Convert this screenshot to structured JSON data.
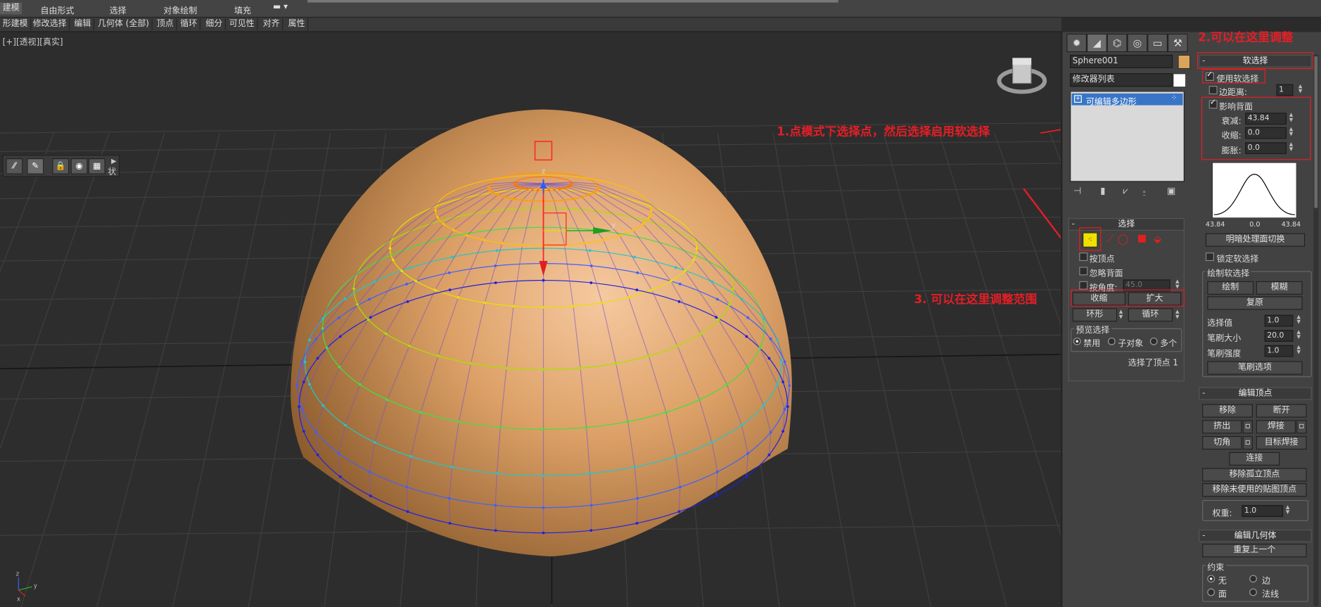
{
  "ribbon": {
    "tabs": [
      "建模",
      "自由形式",
      "选择",
      "对象绘制",
      "填充"
    ],
    "commands": [
      "形建模",
      "修改选择",
      "编辑",
      "几何体 (全部)",
      "顶点",
      "循环",
      "细分",
      "可见性",
      "对齐",
      "属性"
    ]
  },
  "viewport": {
    "label_plus": "[+]",
    "label_view": "[透视]",
    "label_shade": "[真实]",
    "gizmo_axis_z": "z",
    "gizmo_axis_y": "y",
    "corner_axis_z": "z",
    "corner_axis_x": "x",
    "corner_axis_y": "y",
    "float_toolbar_label": "状"
  },
  "command_panel": {
    "object_name": "Sphere001",
    "object_color": "#d9a45c",
    "modifier_list_label": "修改器列表",
    "modifier_stack_item": "可编辑多边形",
    "selection": {
      "title": "选择",
      "by_vertex": "按顶点",
      "ignore_backfacing": "忽略背面",
      "by_angle": "按角度:",
      "by_angle_value": "45.0",
      "shrink": "收缩",
      "grow": "扩大",
      "ring": "环形",
      "loop": "循环",
      "preview_title": "预览选择",
      "preview_disable": "禁用",
      "preview_subobj": "子对象",
      "preview_multi": "多个",
      "status": "选择了顶点 1"
    },
    "soft_selection": {
      "title": "软选择",
      "use_soft": "使用软选择",
      "edge_distance": "边距离:",
      "edge_distance_value": "1",
      "affect_backfacing": "影响背面",
      "falloff": "衰减:",
      "falloff_value": "43.84",
      "pinch": "收缩:",
      "pinch_value": "0.0",
      "bubble": "膨胀:",
      "bubble_value": "0.0",
      "curve_left": "43.84",
      "curve_mid": "0.0",
      "curve_right": "43.84",
      "shaded_face_toggle": "明暗处理面切换",
      "lock_soft": "锁定软选择",
      "paint_group_title": "绘制软选择",
      "paint": "绘制",
      "blur": "模糊",
      "revert": "复原",
      "selection_value": "选择值",
      "selection_value_num": "1.0",
      "brush_size": "笔刷大小",
      "brush_size_num": "20.0",
      "brush_strength": "笔刷强度",
      "brush_strength_num": "1.0",
      "brush_options": "笔刷选项"
    },
    "edit_vertices": {
      "title": "编辑顶点",
      "remove": "移除",
      "break": "断开",
      "extrude": "挤出",
      "weld": "焊接",
      "chamfer": "切角",
      "target_weld": "目标焊接",
      "connect": "连接",
      "remove_isolated": "移除孤立顶点",
      "remove_unused_map": "移除未使用的贴图顶点",
      "weight": "权重:",
      "weight_value": "1.0"
    },
    "edit_geometry": {
      "title": "编辑几何体",
      "repeat_last": "重复上一个",
      "constraints": "约束",
      "c_none": "无",
      "c_edge": "边",
      "c_face": "面",
      "c_normal": "法线"
    }
  },
  "annotations": {
    "a1": "1.点模式下选择点，然后选择启用软选择",
    "a2": "2.可以在这里调整",
    "a3": "3. 可以在这里调整范围"
  },
  "colors": {
    "annotation_red": "#e41e26",
    "vertex_selected": "#ffff00",
    "sphere_base": "#d9a45c"
  }
}
